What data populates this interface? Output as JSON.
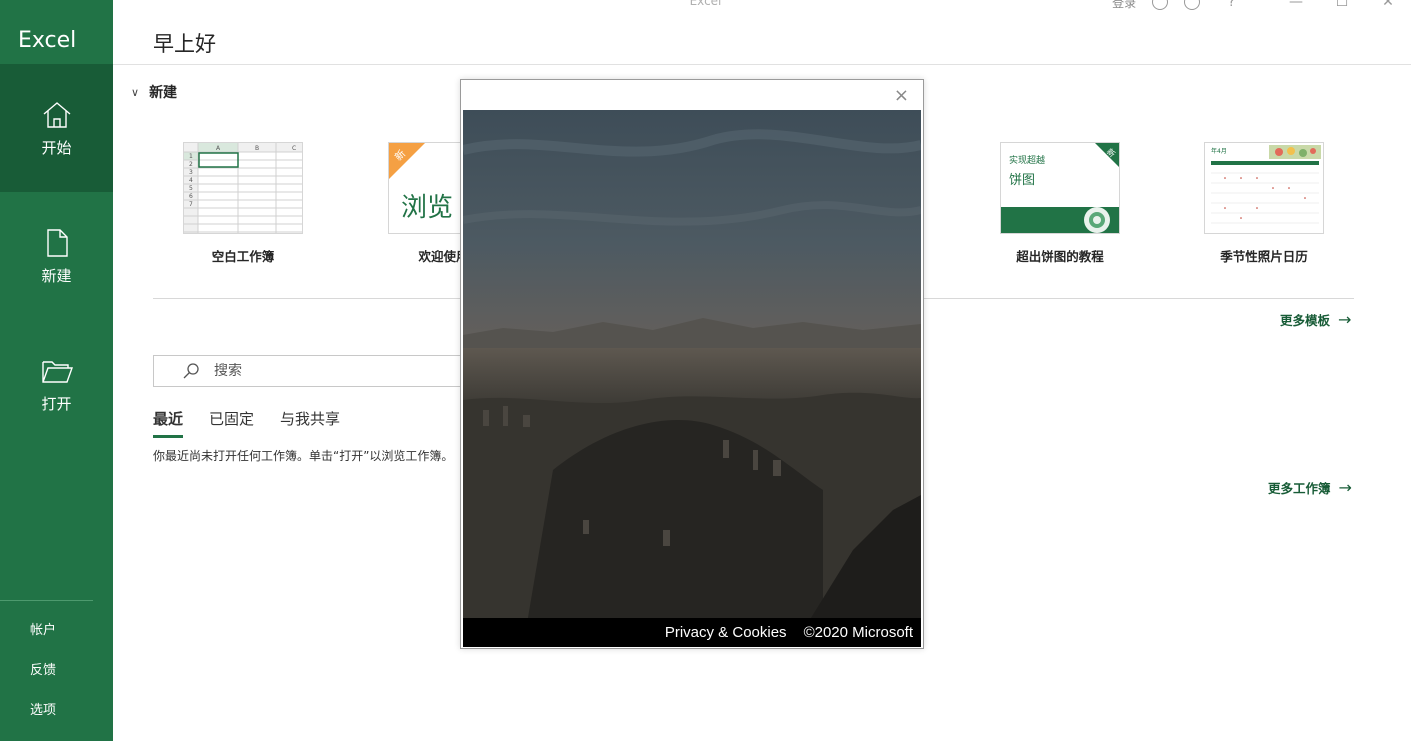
{
  "window": {
    "title": "Excel",
    "signin": "登录",
    "help": "?"
  },
  "sidebar": {
    "app_name": "Excel",
    "items": [
      {
        "label": "开始",
        "icon": "home-icon"
      },
      {
        "label": "新建",
        "icon": "new-file-icon"
      },
      {
        "label": "打开",
        "icon": "folder-open-icon"
      }
    ],
    "bottom": [
      {
        "label": "帐户"
      },
      {
        "label": "反馈"
      },
      {
        "label": "选项"
      }
    ]
  },
  "main": {
    "greeting": "早上好",
    "new_section": {
      "title": "新建",
      "templates": [
        {
          "label": "空白工作簿"
        },
        {
          "label": "欢迎使用 I",
          "thumb_text": "浏览",
          "badge": "新"
        },
        {
          "label": "超出饼图的教程",
          "thumb_text": "实现超越\n饼图",
          "badge": "新"
        },
        {
          "label": "季节性照片日历",
          "thumb_text": "年4月"
        }
      ],
      "more_templates": "更多模板"
    },
    "search": {
      "placeholder": "搜索"
    },
    "tabs": [
      "最近",
      "已固定",
      "与我共享"
    ],
    "empty_message": "你最近尚未打开任何工作簿。单击“打开”以浏览工作簿。",
    "more_workbooks": "更多工作簿"
  },
  "dialog": {
    "close": "×",
    "footer_privacy": "Privacy & Cookies",
    "footer_copyright": "©2020 Microsoft"
  },
  "colors": {
    "brand": "#217346",
    "brand_dark": "#185c37",
    "link": "#185c37"
  }
}
